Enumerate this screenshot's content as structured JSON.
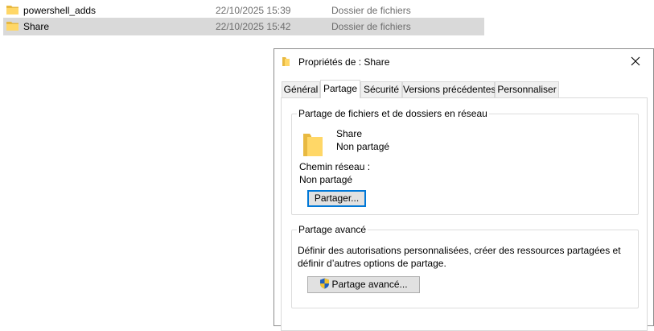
{
  "explorer": {
    "files": [
      {
        "name": "powershell_adds",
        "date": "22/10/2025 15:39",
        "type": "Dossier de fichiers",
        "selected": false
      },
      {
        "name": "Share",
        "date": "22/10/2025 15:42",
        "type": "Dossier de fichiers",
        "selected": true
      }
    ]
  },
  "dialog": {
    "title": "Propriétés de : Share",
    "close_icon": "close-icon",
    "tabs": [
      {
        "label": "Général",
        "active": false
      },
      {
        "label": "Partage",
        "active": true
      },
      {
        "label": "Sécurité",
        "active": false
      },
      {
        "label": "Versions précédentes",
        "active": false
      },
      {
        "label": "Personnaliser",
        "active": false
      }
    ],
    "network_sharing": {
      "group_label": "Partage de fichiers et de dossiers en réseau",
      "folder_name": "Share",
      "share_status": "Non partagé",
      "network_path_label": "Chemin réseau :",
      "network_path_value": "Non partagé",
      "share_button": "Partager..."
    },
    "advanced_sharing": {
      "group_label": "Partage avancé",
      "description": "Définir des autorisations personnalisées, créer des ressources partagées et définir d’autres options de partage.",
      "button": "Partage avancé..."
    }
  },
  "colors": {
    "folder": "#ffd767",
    "folder_dark": "#e8b941",
    "selection": "#d9d9d9",
    "default_button_border": "#0078d7"
  }
}
